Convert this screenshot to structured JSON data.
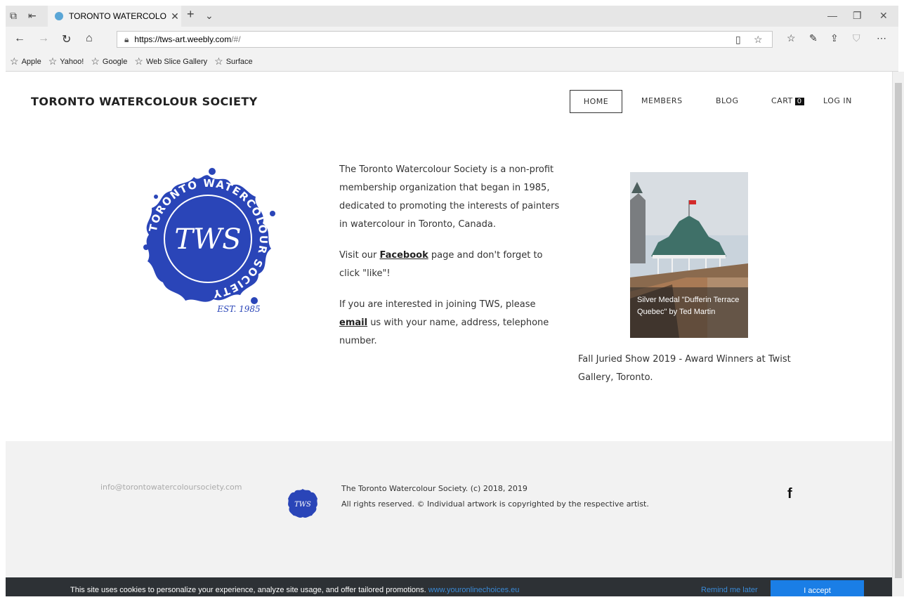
{
  "browser": {
    "tab_title": "TORONTO WATERCOLO",
    "url_host": "https://tws-art.weebly.com",
    "url_path": "/#/",
    "favorites": [
      "Apple",
      "Yahoo!",
      "Google",
      "Web Slice Gallery",
      "Surface"
    ]
  },
  "site": {
    "title": "TORONTO WATERCOLOUR SOCIETY",
    "nav": {
      "home": "HOME",
      "members": "MEMBERS",
      "blog": "BLOG",
      "cart": "CART",
      "cart_count": "0",
      "login": "LOG IN"
    }
  },
  "logo": {
    "ring_text": "TORONTO WATERCOLOUR SOCIETY",
    "monogram": "TWS",
    "established": "EST. 1985"
  },
  "intro": {
    "p1": "The Toronto Watercolour Society is a non-profit membership organization that began in 1985, dedicated to promoting the interests of painters in watercolour in Toronto, Canada.",
    "p2_before": "Visit our ",
    "p2_link": "Facebook",
    "p2_after": " page and don't forget to click \"like\"!",
    "p3_before": "If you are interested in joining TWS, please ",
    "p3_link": "email",
    "p3_after": "  us with your name, address, telephone number."
  },
  "feature": {
    "caption": "Silver Medal \"Dufferin Terrace Quebec\" by Ted Martin",
    "note": "Fall Juried Show 2019 - Award Winners at Twist Gallery, Toronto."
  },
  "footer": {
    "email": "info@torontowatercoloursociety.com",
    "line1": "The Toronto Watercolour Society. (c) 2018, 2019",
    "line2": "All rights reserved. © Individual artwork is copyrighted by the respective artist.",
    "social": "f"
  },
  "cookie": {
    "text": "This site uses cookies to personalize your experience, analyze site usage, and offer tailored promotions.",
    "link": "www.youronlinechoices.eu",
    "remind": "Remind me later",
    "accept": "I accept"
  },
  "colors": {
    "logo_blue": "#2a45b8",
    "cookie_bg": "#2d3135",
    "accept_blue": "#1a7ee6",
    "link_blue": "#3a8bd8",
    "footer_bg": "#f2f2f2"
  }
}
